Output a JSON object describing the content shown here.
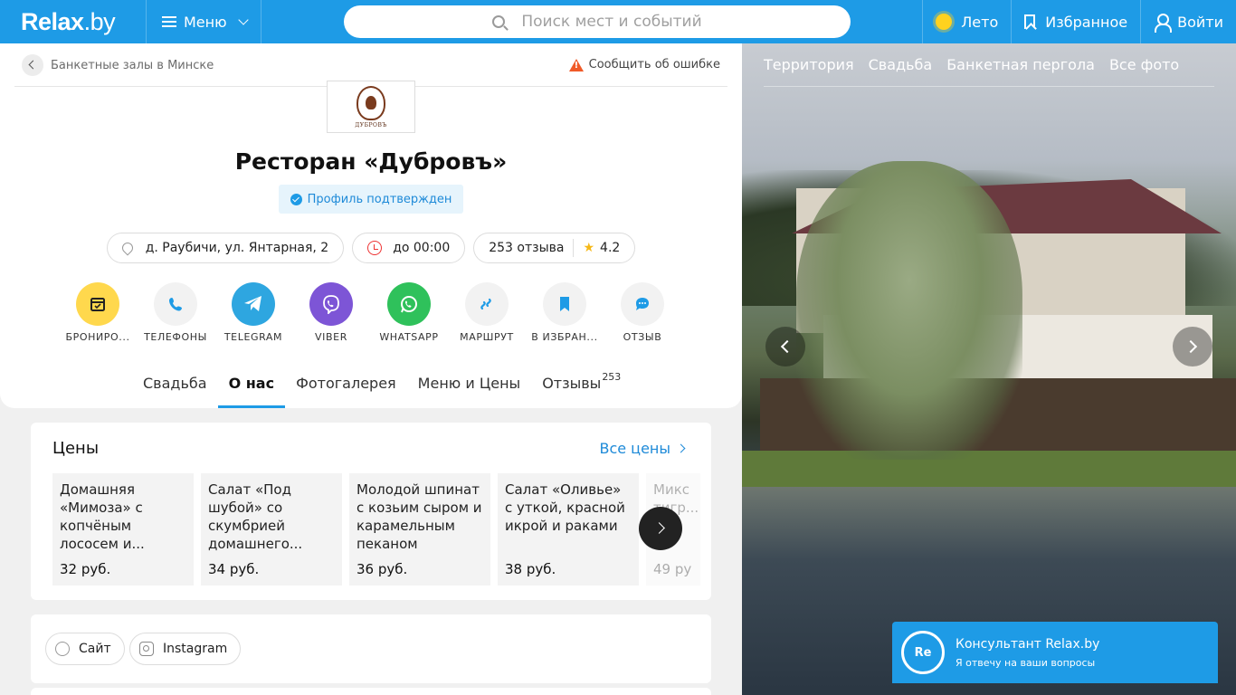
{
  "header": {
    "logo": "Relax",
    "logo_tld": ".by",
    "menu_label": "Меню",
    "search_placeholder": "Поиск мест и событий",
    "season_label": "Лето",
    "favorites_label": "Избранное",
    "login_label": "Войти"
  },
  "breadcrumb": {
    "label": "Банкетные залы в Минске",
    "report_label": "Сообщить об ошибке"
  },
  "venue": {
    "logo_caption": "ДУБРОВЪ",
    "title": "Ресторан «Дубровъ»",
    "verified_label": "Профиль подтвержден",
    "address": "д. Раубичи, ул. Янтарная, 2",
    "hours": "до 00:00",
    "reviews": "253 отзыва",
    "rating": "4.2"
  },
  "actions": [
    {
      "label": "БРОНИРО...",
      "icon": "calendar-icon",
      "color": "#ffd84d"
    },
    {
      "label": "ТЕЛЕФОНЫ",
      "icon": "phone-icon",
      "color": "#f2f2f2"
    },
    {
      "label": "TELEGRAM",
      "icon": "telegram-icon",
      "color": "#2ea6e0"
    },
    {
      "label": "VIBER",
      "icon": "viber-icon",
      "color": "#7d55d6"
    },
    {
      "label": "WHATSAPP",
      "icon": "whatsapp-icon",
      "color": "#2fc15b"
    },
    {
      "label": "МАРШРУТ",
      "icon": "route-icon",
      "color": "#f2f2f2"
    },
    {
      "label": "В ИЗБРАН...",
      "icon": "bookmark-icon",
      "color": "#f2f2f2"
    },
    {
      "label": "ОТЗЫВ",
      "icon": "comment-icon",
      "color": "#f2f2f2"
    }
  ],
  "tabs": [
    {
      "label": "Свадьба",
      "active": false
    },
    {
      "label": "О нас",
      "active": true
    },
    {
      "label": "Фотогалерея",
      "active": false
    },
    {
      "label": "Меню и Цены",
      "active": false
    },
    {
      "label": "Отзывы",
      "count": "253",
      "active": false
    }
  ],
  "prices": {
    "title": "Цены",
    "all_label": "Все цены",
    "items": [
      {
        "name": "Домашняя «Мимоза» с копчёным лососем и...",
        "price": "32 руб."
      },
      {
        "name": "Салат «Под шубой» со скумбрией домашнего...",
        "price": "34 руб."
      },
      {
        "name": "Молодой шпинат с козьим сыром и карамельным пеканом",
        "price": "36 руб."
      },
      {
        "name": "Салат «Оливье» с уткой, красной икрой и раками",
        "price": "38 руб."
      },
      {
        "name": "Микс тигр...",
        "price": "49 ру"
      }
    ]
  },
  "links": {
    "site_label": "Сайт",
    "instagram_label": "Instagram"
  },
  "photo": {
    "tabs": [
      "Территория",
      "Свадьба",
      "Банкетная пергола",
      "Все фото"
    ]
  },
  "consultant": {
    "avatar": "Re",
    "title": "Консультант Relax.by",
    "subtitle": "Я отвечу на ваши вопросы"
  },
  "colors": {
    "brand": "#1e9be6",
    "star": "#f6b817"
  }
}
